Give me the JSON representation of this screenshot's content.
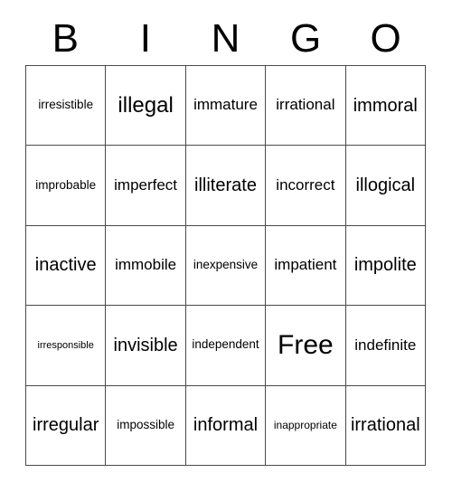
{
  "card": {
    "title_letters": [
      "B",
      "I",
      "N",
      "G",
      "O"
    ],
    "columns": 5,
    "rows": 5,
    "free_space_label": "Free",
    "free_space_position": {
      "row": 4,
      "column": 4
    },
    "border_color": "#4a4a4a",
    "text_color": "#000000",
    "background_color": "#ffffff",
    "cells": [
      [
        {
          "text": "irresistible",
          "size": "xs"
        },
        {
          "text": "illegal",
          "size": "lg"
        },
        {
          "text": "immature",
          "size": "sm"
        },
        {
          "text": "irrational",
          "size": "sm"
        },
        {
          "text": "immoral",
          "size": "md"
        }
      ],
      [
        {
          "text": "improbable",
          "size": "xs"
        },
        {
          "text": "imperfect",
          "size": "sm"
        },
        {
          "text": "illiterate",
          "size": "md"
        },
        {
          "text": "incorrect",
          "size": "sm"
        },
        {
          "text": "illogical",
          "size": "md"
        }
      ],
      [
        {
          "text": "inactive",
          "size": "md"
        },
        {
          "text": "immobile",
          "size": "sm"
        },
        {
          "text": "inexpensive",
          "size": "xs"
        },
        {
          "text": "impatient",
          "size": "sm"
        },
        {
          "text": "impolite",
          "size": "md"
        }
      ],
      [
        {
          "text": "irresponsible",
          "size": "tiny"
        },
        {
          "text": "invisible",
          "size": "md"
        },
        {
          "text": "independent",
          "size": "xs"
        },
        {
          "text": "Free",
          "size": "xl"
        },
        {
          "text": "indefinite",
          "size": "sm"
        }
      ],
      [
        {
          "text": "irregular",
          "size": "md"
        },
        {
          "text": "impossible",
          "size": "xs"
        },
        {
          "text": "informal",
          "size": "md"
        },
        {
          "text": "inappropriate",
          "size": "xxs"
        },
        {
          "text": "irrational",
          "size": "md"
        }
      ]
    ]
  }
}
